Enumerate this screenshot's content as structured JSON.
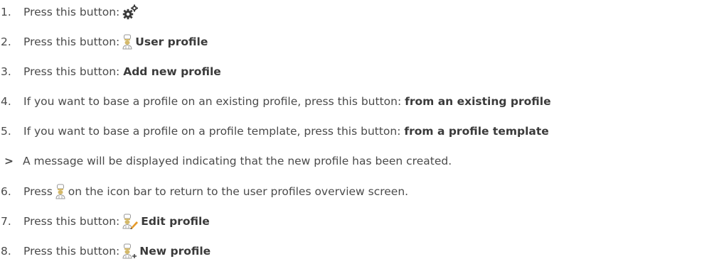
{
  "steps": [
    {
      "number": "1.",
      "text": "Press this button:",
      "icon": "gears-icon",
      "button_label": ""
    },
    {
      "number": "2.",
      "text": "Press this button:",
      "icon": "chef-user-icon",
      "button_label": "User profile"
    },
    {
      "number": "3.",
      "text": "Press this button:",
      "icon": "",
      "button_label": "Add new profile"
    },
    {
      "number": "4.",
      "text": "If you want to base a profile on an existing profile, press this button:",
      "icon": "",
      "button_label": "from an existing profile"
    },
    {
      "number": "5.",
      "text": "If you want to base a profile on a profile template, press this button:",
      "icon": "",
      "button_label": "from a profile template"
    },
    {
      "number": ">",
      "text": "A message will be displayed indicating that the new profile has been created.",
      "icon": "",
      "button_label": ""
    },
    {
      "number": "6.",
      "text_before": "Press",
      "icon": "chef-user-icon",
      "text_after": "on the icon bar to return to the user profiles overview screen."
    },
    {
      "number": "7.",
      "text": "Press this button:",
      "icon": "chef-edit-icon",
      "button_label": "Edit profile"
    },
    {
      "number": "8.",
      "text": "Press this button:",
      "icon": "chef-add-icon",
      "button_label": "New profile"
    }
  ],
  "colors": {
    "text": "#4a4a4a",
    "icon_gold": "#d4b96a",
    "icon_grey": "#9a9a9a",
    "edit_orange": "#e59a2b"
  }
}
